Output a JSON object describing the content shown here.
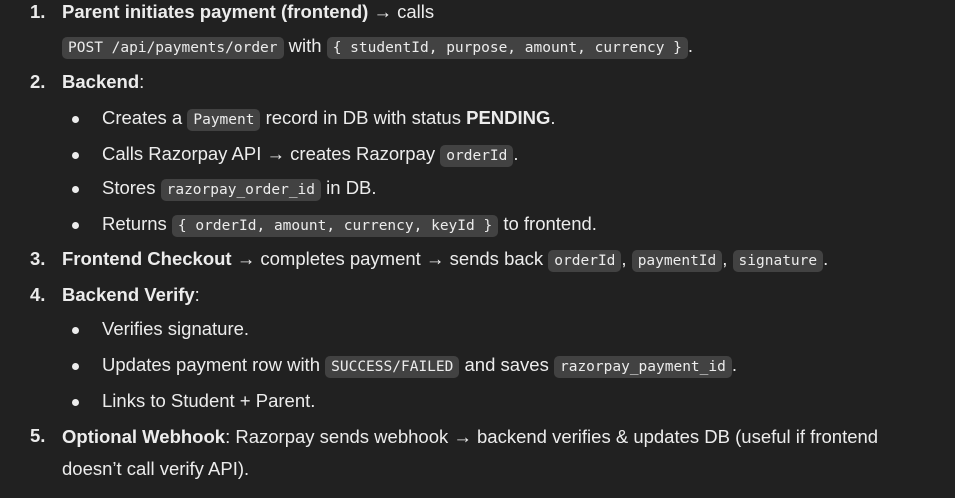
{
  "steps": [
    {
      "num": "1.",
      "title": "Parent initiates payment (frontend)",
      "after_title": " → calls",
      "code_endpoint": "POST /api/payments/order",
      "mid": " with ",
      "code_body": "{ studentId, purpose, amount, currency }",
      "end": "."
    },
    {
      "num": "2.",
      "title": "Backend",
      "after_title": ":",
      "items": [
        {
          "pre": "Creates a ",
          "code": "Payment",
          "mid": " record in DB with status ",
          "bold": "PENDING",
          "end": "."
        },
        {
          "pre": "Calls Razorpay API → creates Razorpay ",
          "code": "orderId",
          "end": "."
        },
        {
          "pre": "Stores ",
          "code": "razorpay_order_id",
          "end": " in DB."
        },
        {
          "pre": "Returns ",
          "code": "{ orderId, amount, currency, keyId }",
          "end": " to frontend."
        }
      ]
    },
    {
      "num": "3.",
      "title": "Frontend Checkout",
      "after_title": " → completes payment → sends back ",
      "code1": "orderId",
      "sep1": ", ",
      "code2": "paymentId",
      "sep2": ", ",
      "code3": "signature",
      "end": "."
    },
    {
      "num": "4.",
      "title": "Backend Verify",
      "after_title": ":",
      "items": [
        {
          "pre": "Verifies signature."
        },
        {
          "pre": "Updates payment row with ",
          "code": "SUCCESS/FAILED",
          "mid": " and saves ",
          "code2": "razorpay_payment_id",
          "end": "."
        },
        {
          "pre": "Links to Student + Parent."
        }
      ]
    },
    {
      "num": "5.",
      "title": "Optional Webhook",
      "after_title": ": Razorpay sends webhook → backend verifies & updates DB (useful if frontend doesn’t call verify API)."
    }
  ]
}
